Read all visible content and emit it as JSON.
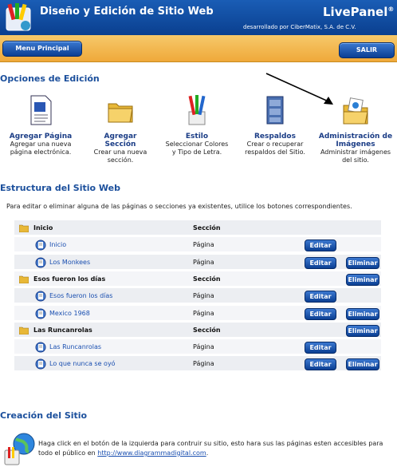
{
  "header": {
    "title": "Diseño y Edición de Sitio Web",
    "brand": "LivePanel",
    "brand_mark": "®",
    "credit": "desarrollado por CiberMatix, S.A. de C.V."
  },
  "nav": {
    "menu_label": "Menu Principal",
    "exit_label": "SALIR"
  },
  "options": {
    "title": "Opciones de Edición",
    "tools": [
      {
        "label": "Agregar Página",
        "desc": "Agregar una nueva página electrónica.",
        "icon": "document-icon"
      },
      {
        "label": "Agregar Sección",
        "desc": "Crear una nueva sección.",
        "icon": "folder-icon"
      },
      {
        "label": "Estilo",
        "desc": "Seleccionar Colores y Tipo de Letra.",
        "icon": "paint-brushes-icon"
      },
      {
        "label": "Respaldos",
        "desc": "Crear o recuperar respaldos del Sitio.",
        "icon": "file-cabinet-icon"
      },
      {
        "label": "Administración de Imágenes",
        "desc": "Administrar imágenes del sitio.",
        "icon": "image-folder-icon"
      }
    ]
  },
  "structure": {
    "title": "Estructura del Sitio Web",
    "intro": "Para editar o eliminar alguna de las páginas o secciones ya existentes, utilice los botones correspondientes.",
    "edit_label": "Editar",
    "delete_label": "Eliminar",
    "rows": [
      {
        "kind": "section",
        "name": "Inicio",
        "type": "Sección",
        "edit": false,
        "delete": false
      },
      {
        "kind": "page",
        "name": "Inicio",
        "type": "Página",
        "edit": true,
        "delete": false
      },
      {
        "kind": "page",
        "name": "Los Monkees",
        "type": "Página",
        "edit": true,
        "delete": true
      },
      {
        "kind": "section",
        "name": "Esos fueron los días",
        "type": "Sección",
        "edit": false,
        "delete": true
      },
      {
        "kind": "page",
        "name": "Esos fueron los días",
        "type": "Página",
        "edit": true,
        "delete": false
      },
      {
        "kind": "page",
        "name": "Mexico 1968",
        "type": "Página",
        "edit": true,
        "delete": true
      },
      {
        "kind": "section",
        "name": "Las Runcanrolas",
        "type": "Sección",
        "edit": false,
        "delete": true
      },
      {
        "kind": "page",
        "name": "Las Runcanrolas",
        "type": "Página",
        "edit": true,
        "delete": false
      },
      {
        "kind": "page",
        "name": "Lo que nunca se oyó",
        "type": "Página",
        "edit": true,
        "delete": true
      }
    ]
  },
  "create": {
    "title": "Creación del Sitio",
    "text": "Haga click en el botón de la izquierda para contruir su sitio, esto hara sus las páginas esten accesibles para todo el público en",
    "link": "http://www.diagrammadigital.com",
    "suffix": "."
  }
}
